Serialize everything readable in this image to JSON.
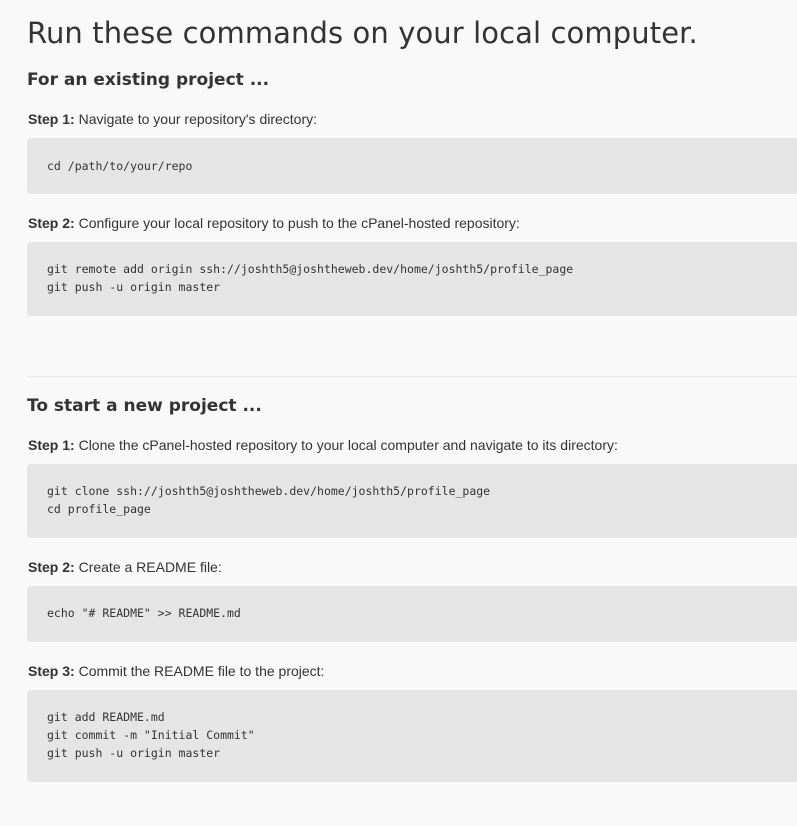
{
  "page_title": "Run these commands on your local computer.",
  "existing": {
    "heading": "For an existing project ...",
    "steps": [
      {
        "label": "Step 1:",
        "text": "Navigate to your repository's directory:",
        "code": [
          "cd /path/to/your/repo"
        ]
      },
      {
        "label": "Step 2:",
        "text": "Configure your local repository to push to the cPanel-hosted repository:",
        "code": [
          "git remote add origin ssh://joshth5@joshtheweb.dev/home/joshth5/profile_page",
          "git push -u origin master"
        ]
      }
    ]
  },
  "new": {
    "heading": "To start a new project ...",
    "steps": [
      {
        "label": "Step 1:",
        "text": "Clone the cPanel-hosted repository to your local computer and navigate to its directory:",
        "code": [
          "git clone ssh://joshth5@joshtheweb.dev/home/joshth5/profile_page",
          "cd profile_page"
        ]
      },
      {
        "label": "Step 2:",
        "text": "Create a README file:",
        "code": [
          "echo \"# README\" >> README.md"
        ]
      },
      {
        "label": "Step 3:",
        "text": "Commit the README file to the project:",
        "code": [
          "git add README.md",
          "git commit -m \"Initial Commit\"",
          "git push -u origin master"
        ]
      }
    ]
  }
}
